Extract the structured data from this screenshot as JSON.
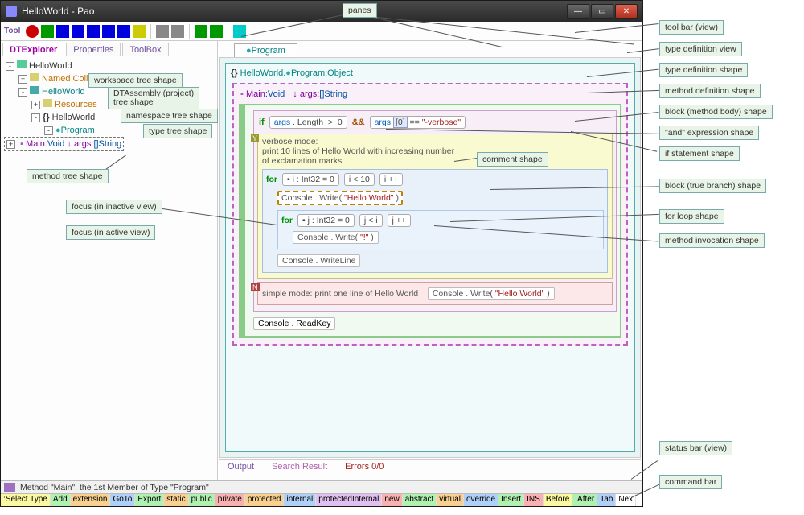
{
  "window": {
    "title": "HelloWorld - Pao"
  },
  "panes_label_top": "panes",
  "tabs_left": {
    "t1": "DTExplorer",
    "t2": "Properties",
    "t3": "ToolBox"
  },
  "tree": {
    "root": "HelloWorld",
    "named": "Named Collections",
    "ns": "HelloWorld",
    "res": "Resources",
    "tns": "HelloWorld",
    "prog": "Program",
    "main_sig_pre": "Main:",
    "main_sig_void": "Void",
    "main_args_arrow": "↓ args:",
    "main_args_type": "[]String"
  },
  "rtab": "Program",
  "typedef_header": {
    "ns": "HelloWorld",
    "cls": "Program",
    "sup": ":Object",
    "braces": "{}"
  },
  "method_sig": {
    "name": "Main",
    "ret": ":Void",
    "arrow": "↓ args:",
    "argtype": "[]String"
  },
  "code": {
    "kw_if": "if",
    "cond1": "args . Length  >  0",
    "amp": "&&",
    "cond2a": "args",
    "cond2idx": "[0]",
    "cond2eq": "==",
    "cond2lit": "\"-verbose\"",
    "yes_comment_l1": "verbose mode:",
    "yes_comment_l2": "print 10 lines of Hello World with increasing number",
    "yes_comment_l3": "of exclamation marks",
    "kw_for": "for",
    "for1_decl": "▪ i : Int32  =  0",
    "for1_cond": "i <  10",
    "for1_inc": "i ++",
    "call1": "Console . Write( \"Hello World\" )",
    "for2_decl": "▪ j : Int32  =  0",
    "for2_cond": "j < i",
    "for2_inc": "j ++",
    "call2": "Console . Write( \"!\" )",
    "call3": "Console . WriteLine",
    "no_comment": "simple mode: print one line of Hello World",
    "call4": "Console . Write( \"Hello World\" )",
    "call5": "Console . ReadKey"
  },
  "bottom_tabs": {
    "out": "Output",
    "sr": "Search Result",
    "err": "Errors 0/0"
  },
  "status": "Method  \"Main\", the 1st Member of Type  \"Program\"",
  "cmds": {
    "c0": ":Select Type",
    "c1": "Add",
    "c2": "extension",
    "c3": "GoTo",
    "c4": "Export",
    "c5": "static",
    "c6": "public",
    "c7": "private",
    "c8": "protected",
    "c9": "internal",
    "c10": "protectedInternal",
    "c11": "new",
    "c12": "abstract",
    "c13": "virtual",
    "c14": "override",
    "c15": "Insert",
    "c16": "INS",
    "c17": "Before",
    "c18": ".After",
    "c19": "Tab",
    "c20": "Nex"
  },
  "labels": {
    "toolbar": "tool bar (view)",
    "typedefview": "type definition view",
    "typedefshape": "type definition shape",
    "methoddefshape": "method definition shape",
    "blockmbody": "block (method body) shape",
    "andexpr": "\"and\" expression shape",
    "ifstmt": "if statement shape",
    "blocktrue": "block (true branch) shape",
    "forloop": "for loop shape",
    "methodinv": "method invocation shape",
    "statusbar": "status bar (view)",
    "cmdbar": "command bar",
    "wstree": "workspace tree shape",
    "dtasm": "DTAssembly (project) tree shape",
    "nstree": "namespace tree shape",
    "typetree": "type tree shape",
    "methodtree": "method tree shape",
    "focusinactive": "focus (in inactive view)",
    "focusactive": "focus (in active view)",
    "commentshape": "comment shape"
  }
}
